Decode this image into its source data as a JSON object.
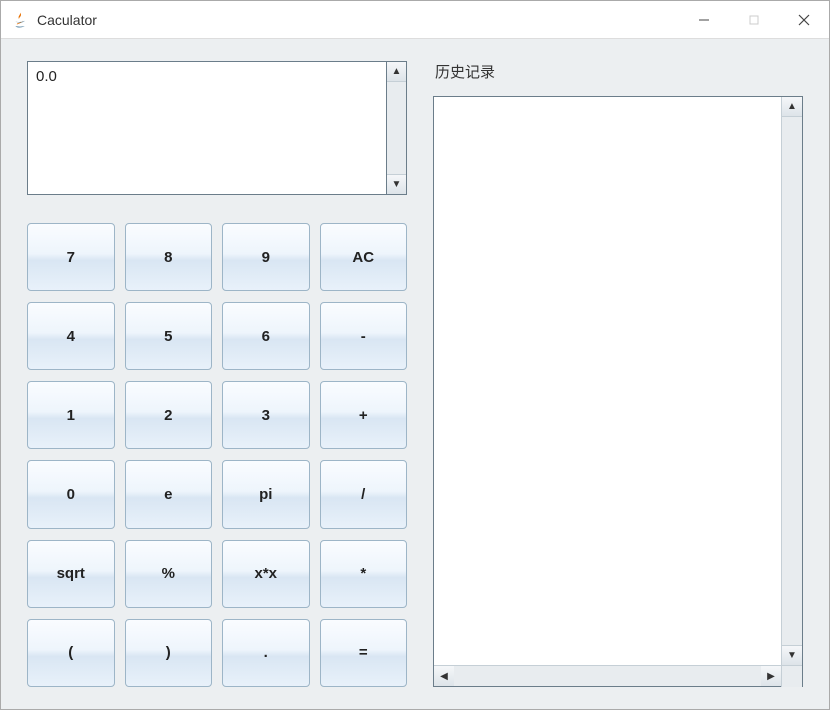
{
  "window": {
    "title": "Caculator"
  },
  "display": {
    "value": "0.0"
  },
  "history": {
    "label": "历史记录",
    "items": []
  },
  "keypad": {
    "rows": [
      [
        "7",
        "8",
        "9",
        "AC"
      ],
      [
        "4",
        "5",
        "6",
        "-"
      ],
      [
        "1",
        "2",
        "3",
        "+"
      ],
      [
        "0",
        "e",
        "pi",
        "/"
      ],
      [
        "sqrt",
        "%",
        "x*x",
        "*"
      ],
      [
        "(",
        ")",
        ".",
        "="
      ]
    ]
  }
}
